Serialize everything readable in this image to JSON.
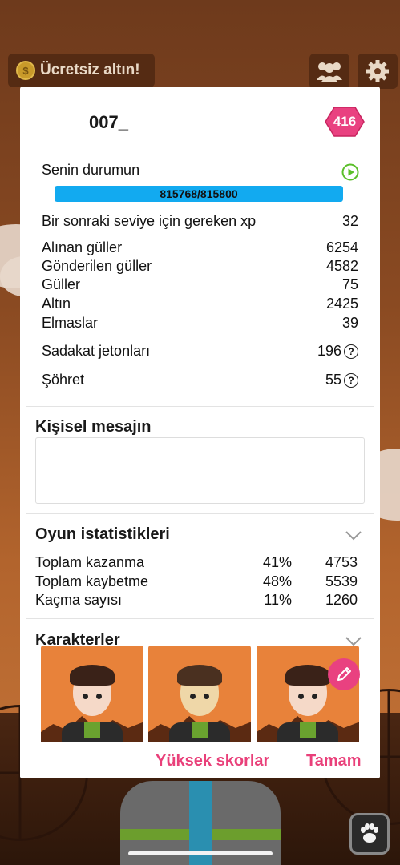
{
  "topbar": {
    "free_gold_label": "Ücretsiz altın!"
  },
  "profile": {
    "username": "007_",
    "level": "416"
  },
  "status": {
    "title": "Senin durumun",
    "xp_text": "815768/815800",
    "xp_progress": 0.99996
  },
  "stats": [
    {
      "label": "Bir sonraki seviye için gereken xp",
      "value": "32"
    },
    {
      "label": "Alınan güller",
      "value": "6254"
    },
    {
      "label": "Gönderilen güller",
      "value": "4582"
    },
    {
      "label": "Güller",
      "value": "75"
    },
    {
      "label": "Altın",
      "value": "2425"
    },
    {
      "label": "Elmaslar",
      "value": "39"
    },
    {
      "label": "Sadakat jetonları",
      "value": "196"
    },
    {
      "label": "Şöhret",
      "value": "55"
    }
  ],
  "personal_message": {
    "title": "Kişisel mesajın",
    "value": ""
  },
  "game_stats": {
    "title": "Oyun istatistikleri",
    "rows": [
      {
        "label": "Toplam kazanma",
        "percent": "41%",
        "count": "4753"
      },
      {
        "label": "Toplam kaybetme",
        "percent": "48%",
        "count": "5539"
      },
      {
        "label": "Kaçma sayısı",
        "percent": "11%",
        "count": "1260"
      }
    ]
  },
  "characters": {
    "title": "Karakterler"
  },
  "footer": {
    "highscores_label": "Yüksek skorlar",
    "ok_label": "Tamam"
  },
  "colors": {
    "accent_pink": "#e9407a",
    "xp_blue": "#12aaf0",
    "play_green": "#5bbf2a"
  }
}
